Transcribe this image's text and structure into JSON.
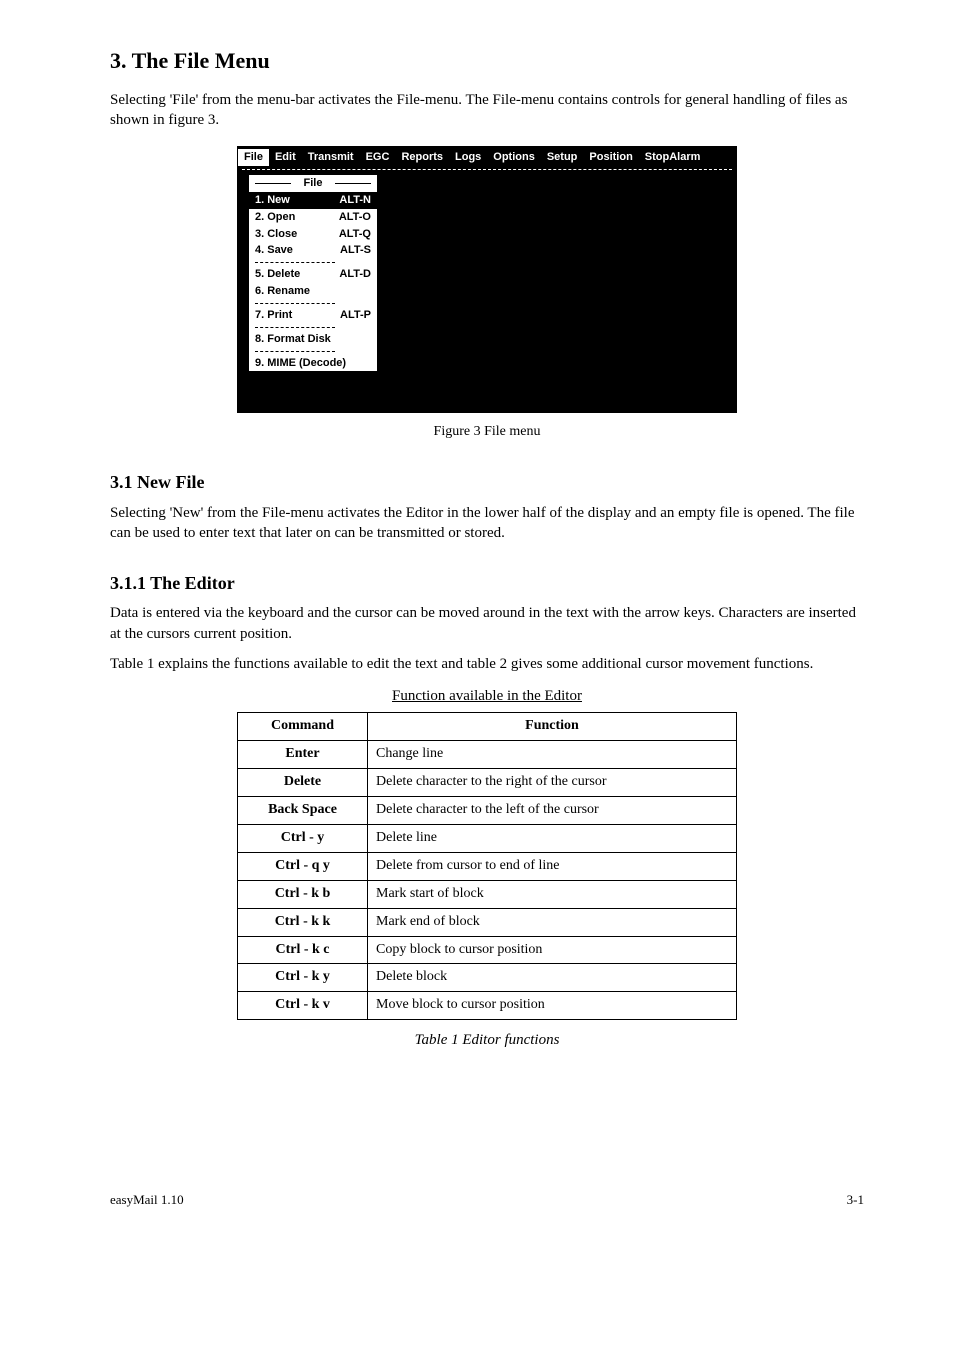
{
  "title": "3. The File Menu",
  "intro1": "Selecting 'File' from the menu-bar activates the File-menu. The File-menu contains controls for general handling of files as shown in figure 3.",
  "menubar": {
    "items": [
      "File",
      "Edit",
      "Transmit",
      "EGC",
      "Reports",
      "Logs",
      "Options",
      "Setup",
      "Position",
      "StopAlarm"
    ],
    "active_index": 0
  },
  "dropdown": {
    "title": "File",
    "groups": [
      [
        {
          "label": "1. New",
          "shortcut": "ALT-N",
          "sel": true
        },
        {
          "label": "2. Open",
          "shortcut": "ALT-O"
        },
        {
          "label": "3. Close",
          "shortcut": "ALT-Q"
        },
        {
          "label": "4. Save",
          "shortcut": "ALT-S"
        }
      ],
      [
        {
          "label": "5. Delete",
          "shortcut": "ALT-D"
        },
        {
          "label": "6. Rename",
          "shortcut": ""
        }
      ],
      [
        {
          "label": "7. Print",
          "shortcut": "ALT-P"
        }
      ],
      [
        {
          "label": "8. Format Disk",
          "shortcut": ""
        }
      ],
      [
        {
          "label": "9. MIME (Decode)",
          "shortcut": ""
        }
      ]
    ]
  },
  "caption": "Figure 3 File menu",
  "sub_newfile": "3.1 New File",
  "newfile_p": "Selecting 'New' from the File-menu activates the Editor in the lower half of the display and an empty file is opened. The file can be used to enter text that later on can be transmitted or stored.",
  "sub_editor": "3.1.1 The Editor",
  "editor_p1": "Data is entered via the keyboard and the cursor can be moved around in the text with the arrow keys. Characters are inserted at the cursors current position.",
  "editor_p2": "Table 1 explains the functions available to edit the text and table 2 gives some additional cursor movement functions.",
  "tabletitle": "Function available in the Editor",
  "chart_data": {
    "type": "table",
    "title": "Table 1 Editor functions",
    "columns": [
      "Command",
      "Function"
    ],
    "rows": [
      [
        "Enter",
        "Change line"
      ],
      [
        "Delete",
        "Delete character to the right of the cursor"
      ],
      [
        "Back Space",
        "Delete character to the left of the cursor"
      ],
      [
        "Ctrl - y",
        "Delete line"
      ],
      [
        "Ctrl - q  y",
        "Delete from cursor to end of line"
      ],
      [
        "Ctrl - k  b",
        "Mark start of block"
      ],
      [
        "Ctrl - k  k",
        "Mark end of block"
      ],
      [
        "Ctrl - k  c",
        "Copy block to cursor position"
      ],
      [
        "Ctrl - k  y",
        "Delete block"
      ],
      [
        "Ctrl - k  v",
        "Move block to cursor position"
      ]
    ]
  },
  "footer_left": "easyMail 1.10",
  "footer_right": "3-1"
}
